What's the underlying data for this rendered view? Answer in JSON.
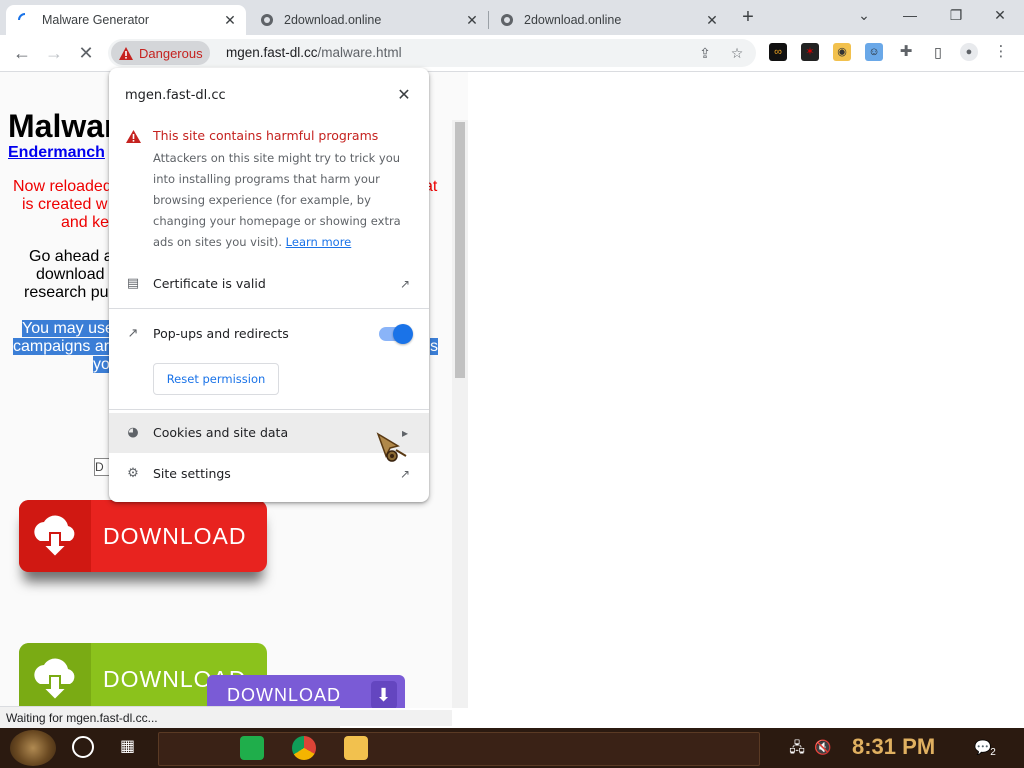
{
  "tabs": [
    {
      "title": "Malware Generator",
      "active": true
    },
    {
      "title": "2download.online",
      "active": false
    },
    {
      "title": "2download.online",
      "active": false
    }
  ],
  "new_tab_label": "+",
  "window_controls": {
    "minimize": "—",
    "restore": "❐",
    "close": "✕",
    "tab_search": "⌄"
  },
  "toolbar": {
    "security_label": "Dangerous",
    "url_host": "mgen.fast-dl.cc",
    "url_path": "/malware.html"
  },
  "page": {
    "title": "Malwar",
    "author_link": "Endermanch",
    "red_lines": [
      "Now reloaded",
      "is created w",
      "and ke"
    ],
    "red_right": "at",
    "black_lines": [
      "Go ahead a",
      "download",
      "research pu"
    ],
    "selected_lines": [
      "You may use",
      "campaigns ar",
      "yo"
    ],
    "selected_right_a": "s",
    "d_box": "D",
    "buttons": [
      {
        "label": "DOWNLOAD",
        "color": "#e8231f"
      },
      {
        "label": "DOWNLOAD",
        "color": "#8bc21c"
      },
      {
        "label": "DOWNLOAD",
        "color": "#7a5bd6"
      }
    ]
  },
  "status_text": "Waiting for mgen.fast-dl.cc...",
  "popup": {
    "host": "mgen.fast-dl.cc",
    "close": "✕",
    "warning_title": "This site contains harmful programs",
    "warning_body": "Attackers on this site might try to trick you into installing programs that harm your browsing experience (for example, by changing your homepage or showing extra ads on sites you visit). ",
    "learn_more": "Learn more",
    "certificate": "Certificate is valid",
    "popups": "Pop-ups and redirects",
    "popups_enabled": true,
    "reset": "Reset permission",
    "cookies": "Cookies and site data",
    "site_settings": "Site settings"
  },
  "taskbar": {
    "time": "8:31 PM",
    "notifications": "2"
  }
}
